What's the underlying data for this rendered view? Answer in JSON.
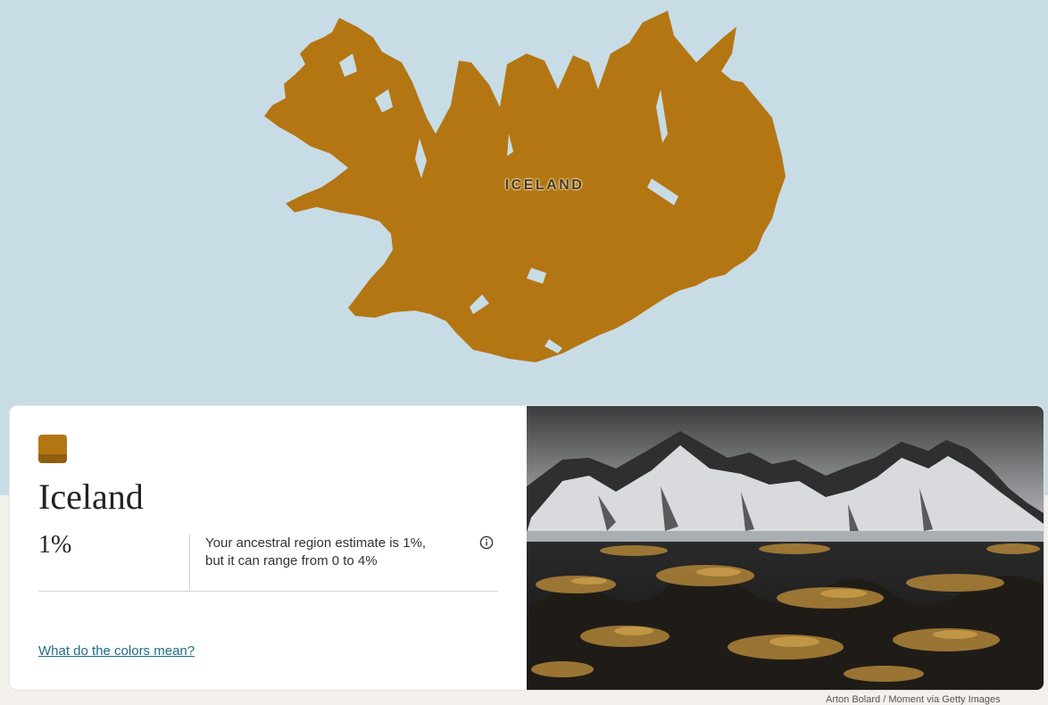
{
  "map": {
    "region_label": "ICELAND",
    "land_color": "#b37613",
    "water_color": "#c8dce6"
  },
  "card": {
    "swatch_color": "#b37613",
    "swatch_shade": "#8f5e0e",
    "region_name": "Iceland",
    "percentage": "1%",
    "estimate_line1": "Your ancestral region estimate is 1%,",
    "estimate_line2": "but it can range from 0 to 4%",
    "info_icon": "info-circle-icon",
    "colors_link": "What do the colors mean?"
  },
  "photo": {
    "subject": "snow-capped mountains above black sand dunes with golden grass"
  },
  "credit": "Arton Bolard / Moment via Getty Images"
}
